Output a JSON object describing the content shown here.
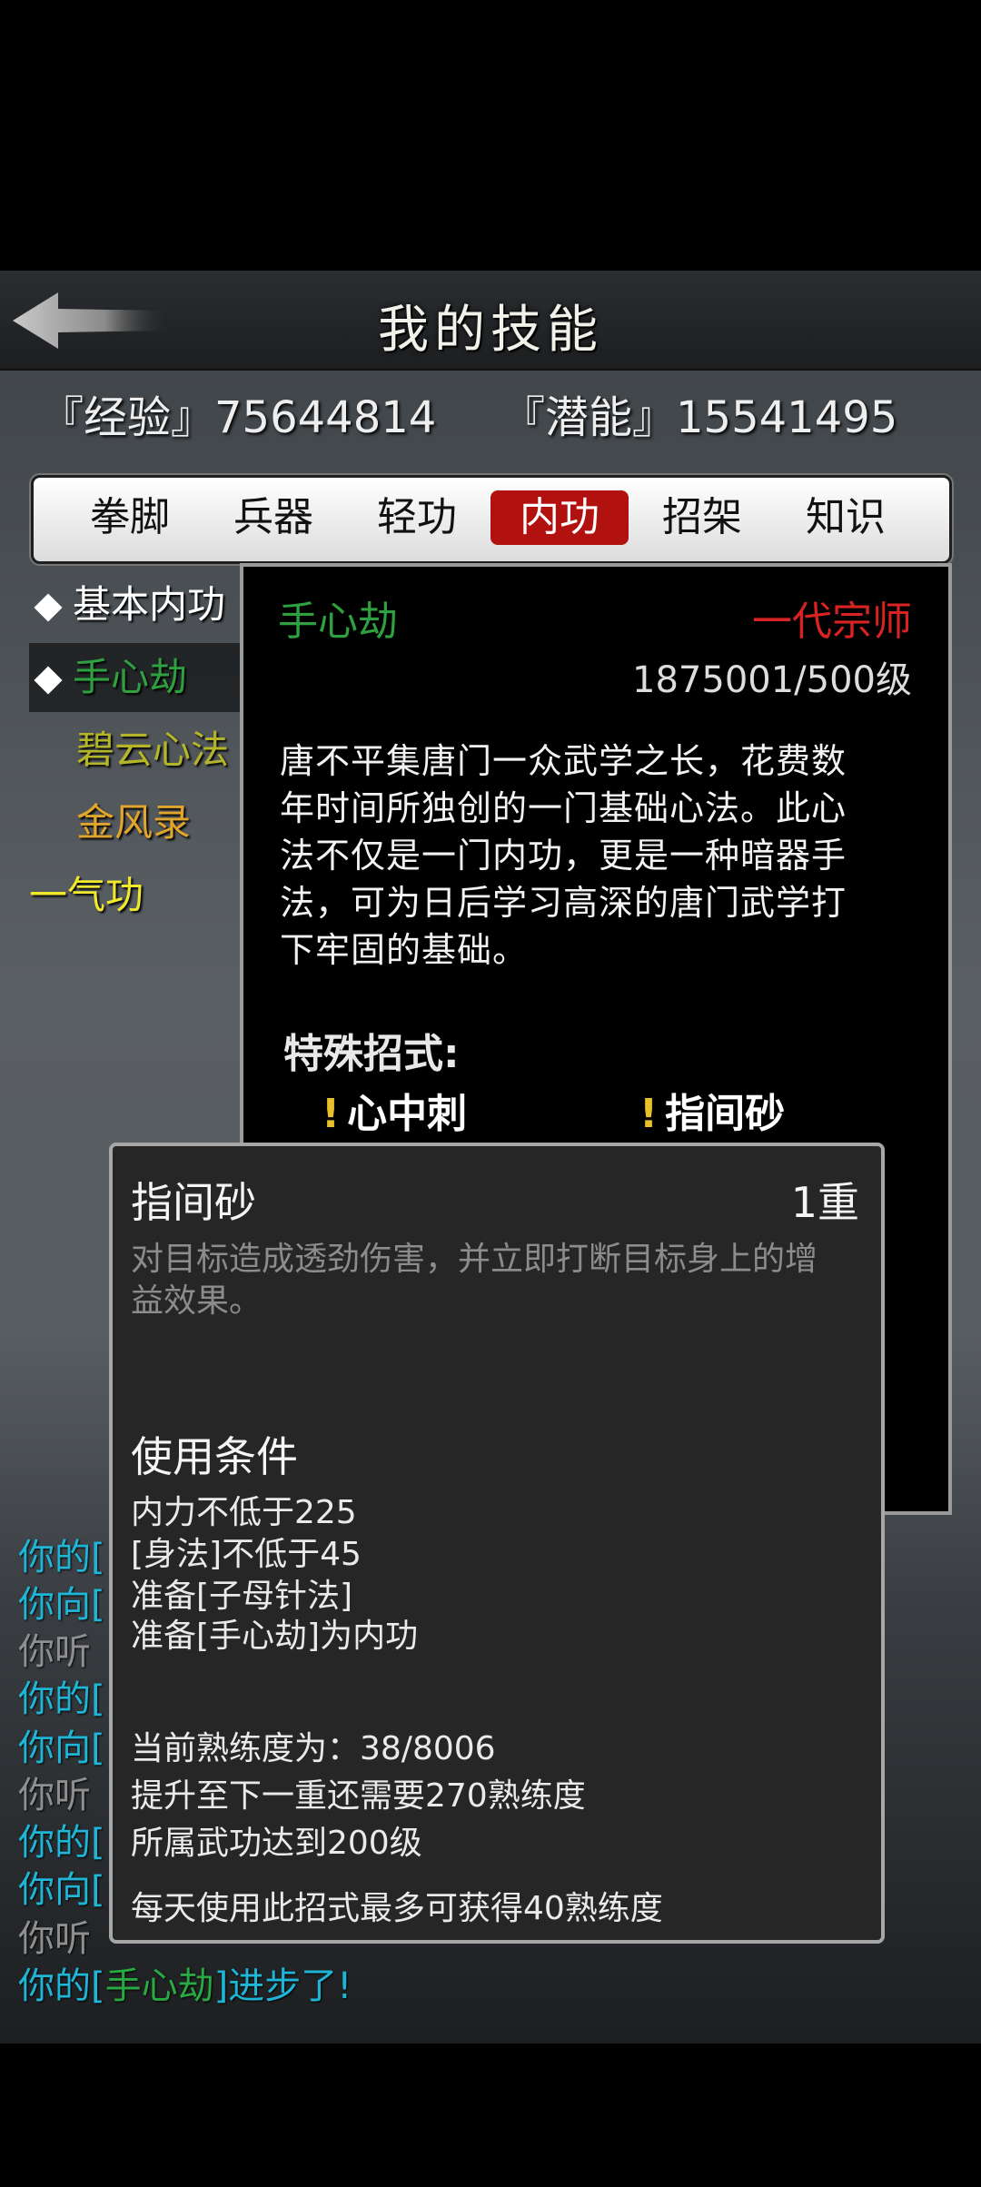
{
  "header": {
    "title": "我的技能"
  },
  "stats": {
    "exp": "『经验』75644814",
    "potential": "『潜能』15541495"
  },
  "tabs": [
    {
      "label": "拳脚"
    },
    {
      "label": "兵器"
    },
    {
      "label": "轻功"
    },
    {
      "label": "内功"
    },
    {
      "label": "招架"
    },
    {
      "label": "知识"
    }
  ],
  "active_tab": "内功",
  "skills": [
    {
      "label": "基本内功",
      "color": "#ffffff"
    },
    {
      "label": "手心劫",
      "color": "#2fa03f"
    },
    {
      "label": "碧云心法",
      "color": "#b5b52a"
    },
    {
      "label": "金风录",
      "color": "#e0a52a"
    },
    {
      "label": "一气功",
      "color": "#f0e82c"
    }
  ],
  "detail": {
    "name": "手心劫",
    "rank": "一代宗师",
    "level": "1875001/500级",
    "description_lines": [
      "唐不平集唐门一众武学之长，花费数",
      "年时间所独创的一门基础心法。此心",
      "法不仅是一门内功，更是一种暗器手",
      "法，可为日后学习高深的唐门武学打",
      "下牢固的基础。"
    ],
    "special_title": "特殊招式:",
    "moves": [
      {
        "bang": "!",
        "label": "心中刺"
      },
      {
        "bang": "!",
        "label": "指间砂"
      }
    ]
  },
  "popup": {
    "name": "指间砂",
    "level": "1重",
    "description_lines": [
      "对目标造成透劲伤害，并立即打断目标身上的增",
      "益效果。"
    ],
    "conditions_title": "使用条件",
    "conditions": [
      "内力不低于225",
      "[身法]不低于45",
      "准备[子母针法]",
      "准备[手心劫]为内功"
    ],
    "proficiency": [
      "当前熟练度为：38/8006",
      "提升至下一重还需要270熟练度",
      "所属武功达到200级"
    ],
    "daily_limit": "每天使用此招式最多可获得40熟练度"
  },
  "chat": [
    {
      "text": "你的[",
      "color": "cyan"
    },
    {
      "text": "你向[",
      "color": "cyan"
    },
    {
      "text": "你听",
      "color": "grey"
    },
    {
      "text": "你的[",
      "color": "cyan"
    },
    {
      "text": "你向[",
      "color": "cyan"
    },
    {
      "text": "你听",
      "color": "grey"
    },
    {
      "text": "你的[",
      "color": "cyan"
    },
    {
      "text": "你向[",
      "color": "cyan"
    },
    {
      "text": "你听",
      "color": "grey"
    }
  ],
  "chat_last": {
    "prefix": "你的[",
    "skill": "手心劫",
    "suffix": "]进步了!"
  }
}
